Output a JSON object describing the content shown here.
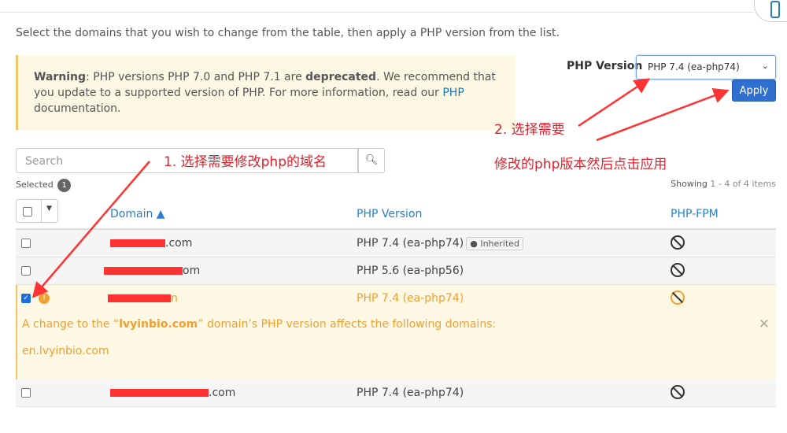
{
  "intro": "Select the domains that you wish to change from the table, then apply a PHP version from the list.",
  "warning": {
    "label": "Warning",
    "text1": ": PHP versions PHP 7.0 and PHP 7.1 are ",
    "bold": "deprecated",
    "text2": ". We recommend that you update to a supported version of PHP. For more information, read our ",
    "link": "PHP",
    "text3": " documentation."
  },
  "php_version_label": "PHP Version",
  "php_select_value": "PHP 7.4 (ea-php74)",
  "apply_label": "Apply",
  "search_placeholder": "Search",
  "selected_label": "Selected",
  "selected_count": "1",
  "showing": {
    "prefix": "Showing",
    "range": "1 - 4 of 4 items"
  },
  "columns": {
    "domain": "Domain ▲",
    "version": "PHP Version",
    "fpm": "PHP-FPM"
  },
  "rows": [
    {
      "domain_suffix": ".com",
      "version": "PHP 7.4 (ea-php74)",
      "badge": "Inherited",
      "checked": false
    },
    {
      "domain_suffix": "om",
      "version": "PHP 5.6 (ea-php56)",
      "checked": false
    },
    {
      "domain_suffix": "n",
      "version": "PHP 7.4 (ea-php74)",
      "checked": true
    },
    {
      "domain_suffix": ".com",
      "version": "PHP 7.4 (ea-php74)",
      "checked": false
    }
  ],
  "alert": {
    "pre": "A change to the “",
    "domain": "lvyinbio.com",
    "post": "” domain’s PHP version affects the following domains:",
    "affected": "en.lvyinbio.com"
  },
  "annotations": {
    "step1": "1.  选择需要修改php的域名",
    "step2a": "2. 选择需要",
    "step2b": "修改的php版本然后点击应用"
  },
  "colors": {
    "accent": "#2f6fd0",
    "warning": "#f0a030",
    "annotation": "#e0202a"
  }
}
